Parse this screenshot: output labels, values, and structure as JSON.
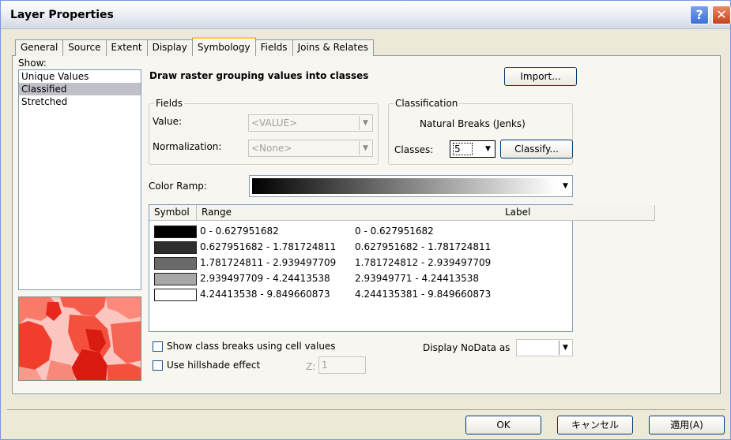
{
  "window": {
    "title": "Layer Properties",
    "help_label": "?",
    "close_label": "✕"
  },
  "tabs": [
    "General",
    "Source",
    "Extent",
    "Display",
    "Symbology",
    "Fields",
    "Joins & Relates"
  ],
  "active_tab": "Symbology",
  "show": {
    "label": "Show:",
    "items": [
      "Unique Values",
      "Classified",
      "Stretched"
    ],
    "selected": "Classified"
  },
  "heading": "Draw raster grouping values into classes",
  "import_button": "Import...",
  "fields": {
    "title": "Fields",
    "value_label": "Value:",
    "value": "<VALUE>",
    "normalization_label": "Normalization:",
    "normalization": "<None>"
  },
  "classification": {
    "title": "Classification",
    "method": "Natural Breaks (Jenks)",
    "classes_label": "Classes:",
    "classes_value": "5",
    "classify_button": "Classify..."
  },
  "color_ramp": {
    "label": "Color Ramp:",
    "from": "#000000",
    "to": "#ffffff"
  },
  "table": {
    "headers": [
      "Symbol",
      "Range",
      "Label"
    ],
    "rows": [
      {
        "color": "#000000",
        "range": "0 - 0.627951682",
        "label": "0 - 0.627951682"
      },
      {
        "color": "#2e2e2e",
        "range": "0.627951682 - 1.781724811",
        "label": "0.627951682 - 1.781724811"
      },
      {
        "color": "#6a6a6a",
        "range": "1.781724811 - 2.939497709",
        "label": "1.781724812 - 2.939497709"
      },
      {
        "color": "#a8a8a8",
        "range": "2.939497709 - 4.24413538",
        "label": "2.93949771 - 4.24413538"
      },
      {
        "color": "#ffffff",
        "range": "4.24413538 - 9.849660873",
        "label": "4.244135381 - 9.849660873"
      }
    ]
  },
  "options": {
    "show_breaks_label": "Show class breaks using cell values",
    "hillshade_label": "Use hillshade effect",
    "z_label": "Z:",
    "z_value": "1",
    "nodata_label": "Display NoData as"
  },
  "buttons": {
    "ok": "OK",
    "cancel": "キャンセル",
    "apply": "適用(A)"
  }
}
